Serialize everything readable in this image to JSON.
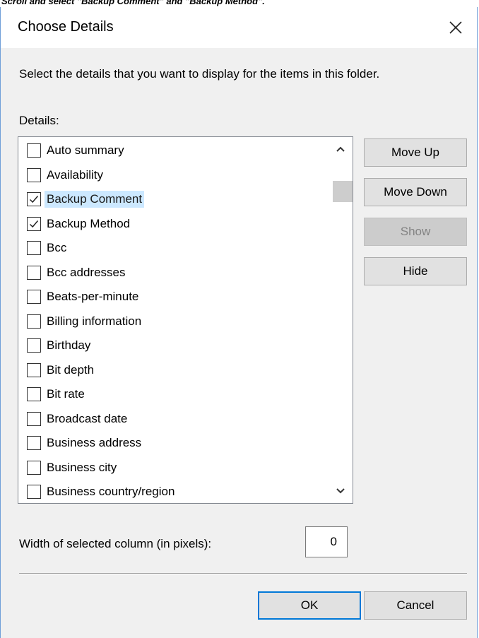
{
  "caption": "Scroll and select \"Backup Comment\" and \"Backup Method\".",
  "dialog": {
    "title": "Choose Details",
    "description": "Select the details that you want to display for the items in this folder.",
    "details_label": "Details:",
    "items": [
      {
        "label": "Auto summary",
        "checked": false,
        "selected": false
      },
      {
        "label": "Availability",
        "checked": false,
        "selected": false
      },
      {
        "label": "Backup Comment",
        "checked": true,
        "selected": true
      },
      {
        "label": "Backup Method",
        "checked": true,
        "selected": false
      },
      {
        "label": "Bcc",
        "checked": false,
        "selected": false
      },
      {
        "label": "Bcc addresses",
        "checked": false,
        "selected": false
      },
      {
        "label": "Beats-per-minute",
        "checked": false,
        "selected": false
      },
      {
        "label": "Billing information",
        "checked": false,
        "selected": false
      },
      {
        "label": "Birthday",
        "checked": false,
        "selected": false
      },
      {
        "label": "Bit depth",
        "checked": false,
        "selected": false
      },
      {
        "label": "Bit rate",
        "checked": false,
        "selected": false
      },
      {
        "label": "Broadcast date",
        "checked": false,
        "selected": false
      },
      {
        "label": "Business address",
        "checked": false,
        "selected": false
      },
      {
        "label": "Business city",
        "checked": false,
        "selected": false
      },
      {
        "label": "Business country/region",
        "checked": false,
        "selected": false
      },
      {
        "label": "",
        "checked": false,
        "selected": false
      }
    ],
    "buttons": {
      "move_up": "Move Up",
      "move_down": "Move Down",
      "show": "Show",
      "hide": "Hide",
      "ok": "OK",
      "cancel": "Cancel"
    },
    "width_label": "Width of selected column (in pixels):",
    "width_value": "0"
  },
  "colors": {
    "selection": "#cce8ff",
    "default_button_border": "#0078d7",
    "dialog_background": "#f0f0f0"
  },
  "icons": {
    "close": "close-icon",
    "check": "checkmark-icon",
    "scroll_up": "chevron-up-icon",
    "scroll_down": "chevron-down-icon"
  }
}
